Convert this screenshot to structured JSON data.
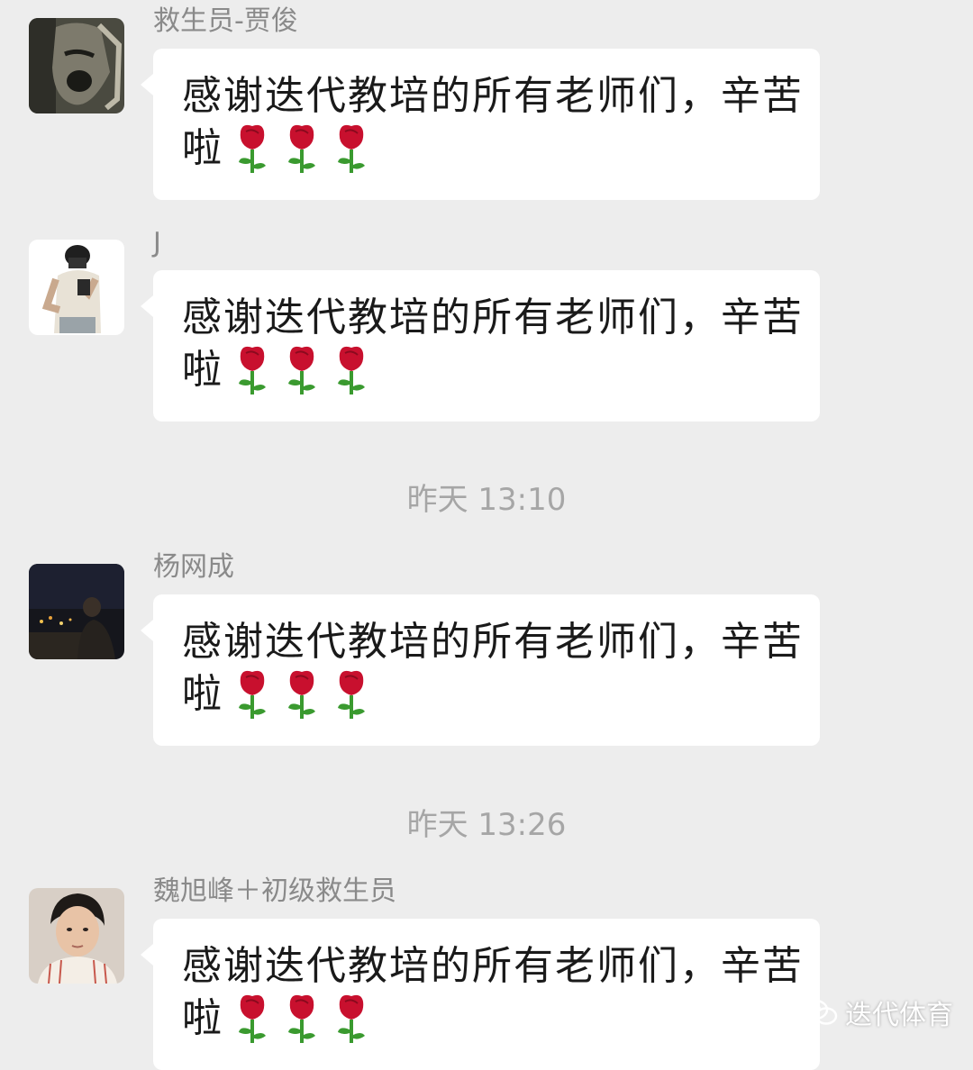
{
  "messages": [
    {
      "sender": "救生员-贾俊",
      "line1": "感谢迭代教培的所有老师们，辛苦",
      "line2": "啦",
      "emoji": [
        "rose",
        "rose",
        "rose"
      ]
    },
    {
      "sender": "J",
      "line1": "感谢迭代教培的所有老师们，辛苦",
      "line2": "啦",
      "emoji": [
        "rose",
        "rose",
        "rose"
      ]
    },
    {
      "sender": "杨网成",
      "line1": "感谢迭代教培的所有老师们，辛苦",
      "line2": "啦",
      "emoji": [
        "rose",
        "rose",
        "rose"
      ]
    },
    {
      "sender": "魏旭峰＋初级救生员",
      "line1": "感谢迭代教培的所有老师们，辛苦",
      "line2": "啦",
      "emoji": [
        "rose",
        "rose",
        "rose"
      ]
    }
  ],
  "timestamps": [
    "昨天 13:10",
    "昨天 13:26"
  ],
  "watermark": {
    "text": "迭代体育",
    "icon": "wechat-icon"
  },
  "colors": {
    "background": "#ededed",
    "bubble": "#ffffff",
    "sender": "#8a8a8a",
    "timestamp": "#a6a6a6",
    "rose": "#c8102e",
    "stem": "#3a9a2f"
  }
}
